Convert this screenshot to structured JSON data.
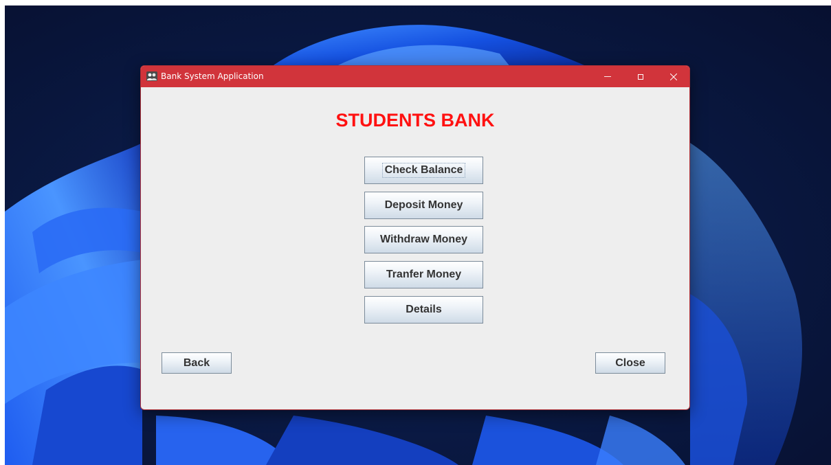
{
  "window": {
    "title": "Bank System Application"
  },
  "icons": {
    "app": "app-users-icon",
    "minimize": "minimize-icon",
    "maximize": "maximize-icon",
    "close": "close-icon"
  },
  "colors": {
    "titlebar": "#d1343b",
    "heading": "#ff1111",
    "window_bg": "#eeeeee"
  },
  "main": {
    "heading": "STUDENTS BANK",
    "buttons": {
      "check_balance": "Check Balance",
      "deposit_money": "Deposit Money",
      "withdraw_money": "Withdraw Money",
      "transfer_money": "Tranfer Money",
      "details": "Details"
    }
  },
  "footer": {
    "back": "Back",
    "close": "Close"
  }
}
